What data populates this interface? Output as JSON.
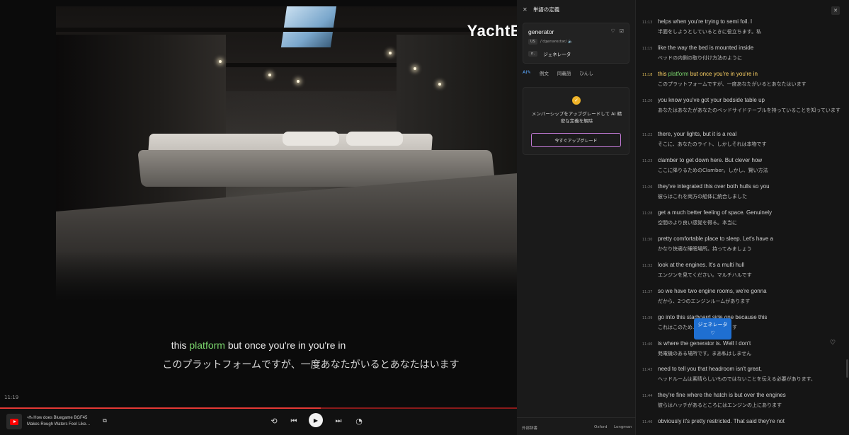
{
  "video": {
    "watermark": "YachtE",
    "subtitle_en": {
      "before": "this ",
      "highlight": "platform",
      "after": " but once you're in you're in"
    },
    "subtitle_jp": "このプラットフォームですが、一度あなたがいるとあなたはいます",
    "timestamp": "11:19",
    "progress": 0.62
  },
  "controls": {
    "now_playing": "🛥 How does Bluegame BGF45 Makes Rough Waters Feel Like…",
    "icons": [
      "youtube-icon",
      "minimize-icon",
      "repeat-icon",
      "previous-icon",
      "play-icon",
      "next-icon",
      "speed-icon"
    ]
  },
  "definition": {
    "title": "単語の定義",
    "word": "generator",
    "pron_tag": "US",
    "pronunciation": "/ˈdʒenəreɪtər/ 🔈",
    "pos": "n.",
    "meaning": "ジェネレータ",
    "tabs": [
      "AI✎",
      "例文",
      "同義語",
      "ひんし"
    ],
    "upgrade_text": "メンバーシップをアップグレードして AI 精密な定義を解除",
    "upgrade_button": "今すぐアップグレード",
    "footer": {
      "ext": "外部辞書",
      "oxford": "Oxford",
      "longman": "Longman"
    }
  },
  "transcript": {
    "rows": [
      {
        "ts": "11:13",
        "en": "helps when you're trying to semi foil. I",
        "jp": "半面をしようとしているときに役立ちます。私"
      },
      {
        "ts": "11:15",
        "en": "like the way the bed is mounted inside",
        "jp": "ベッドの内側の取り付け方法のように"
      },
      {
        "ts": "11:18",
        "en_before": "this ",
        "en_hl": "platform",
        "en_after": " but once you're in you're in",
        "jp": "このプラットフォームですが、一度あなたがいるとあなたはいます",
        "active": true
      },
      {
        "ts": "11:20",
        "en": "you know you've got your bedside table up",
        "jp": "あなたはあなたがあなたのベッドサイドテーブルを持っていることを知っています"
      },
      {
        "ts": "11:22",
        "en": "there, your lights, but it is a real",
        "jp": "そこに、あなたのライト、しかしそれは本物です"
      },
      {
        "ts": "11:23",
        "en": "clamber to get down here. But clever how",
        "jp": "ここに降りるためのClamber。しかし、賢い方法"
      },
      {
        "ts": "11:26",
        "en": "they've integrated this over both hulls so you",
        "jp": "彼らはこれを両方の船体に統合しました"
      },
      {
        "ts": "11:28",
        "en": "get a much better feeling of space. Genuinely",
        "jp": "空間のより良い感覚を得る。本当に"
      },
      {
        "ts": "11:30",
        "en": "pretty comfortable place to sleep. Let's have a",
        "jp": "かなり快適な睡眠場所。持ってみましょう"
      },
      {
        "ts": "11:32",
        "en": "look at the engines. It's a multi hull",
        "jp": "エンジンを見てください。マルチハルです"
      },
      {
        "ts": "11:37",
        "en": "so we have two engine rooms, we're gonna",
        "jp": "だから、2つのエンジンルームがあります"
      },
      {
        "ts": "11:39",
        "en": "go into this starboard side one because this",
        "jp": "これはこのため…右舷側に入ります"
      },
      {
        "ts": "11:40",
        "en": "is where the generator is. Well I don't",
        "jp": "発電機のある場所です。まあ私はしません"
      },
      {
        "ts": "11:43",
        "en": "need to tell you that headroom isn't great,",
        "jp": "ヘッドルームは素晴らしいものではないことを伝える必要があります、"
      },
      {
        "ts": "11:44",
        "en": "they're fine where the hatch is but over the engines",
        "jp": "彼らはハッチがあるところにはエンジンの上にあります"
      },
      {
        "ts": "11:46",
        "en": "obviously it's pretty restricted. That said they're not",
        "jp": ""
      }
    ],
    "tooltip": {
      "text": "ジェネレータ",
      "icon": "♡"
    }
  }
}
